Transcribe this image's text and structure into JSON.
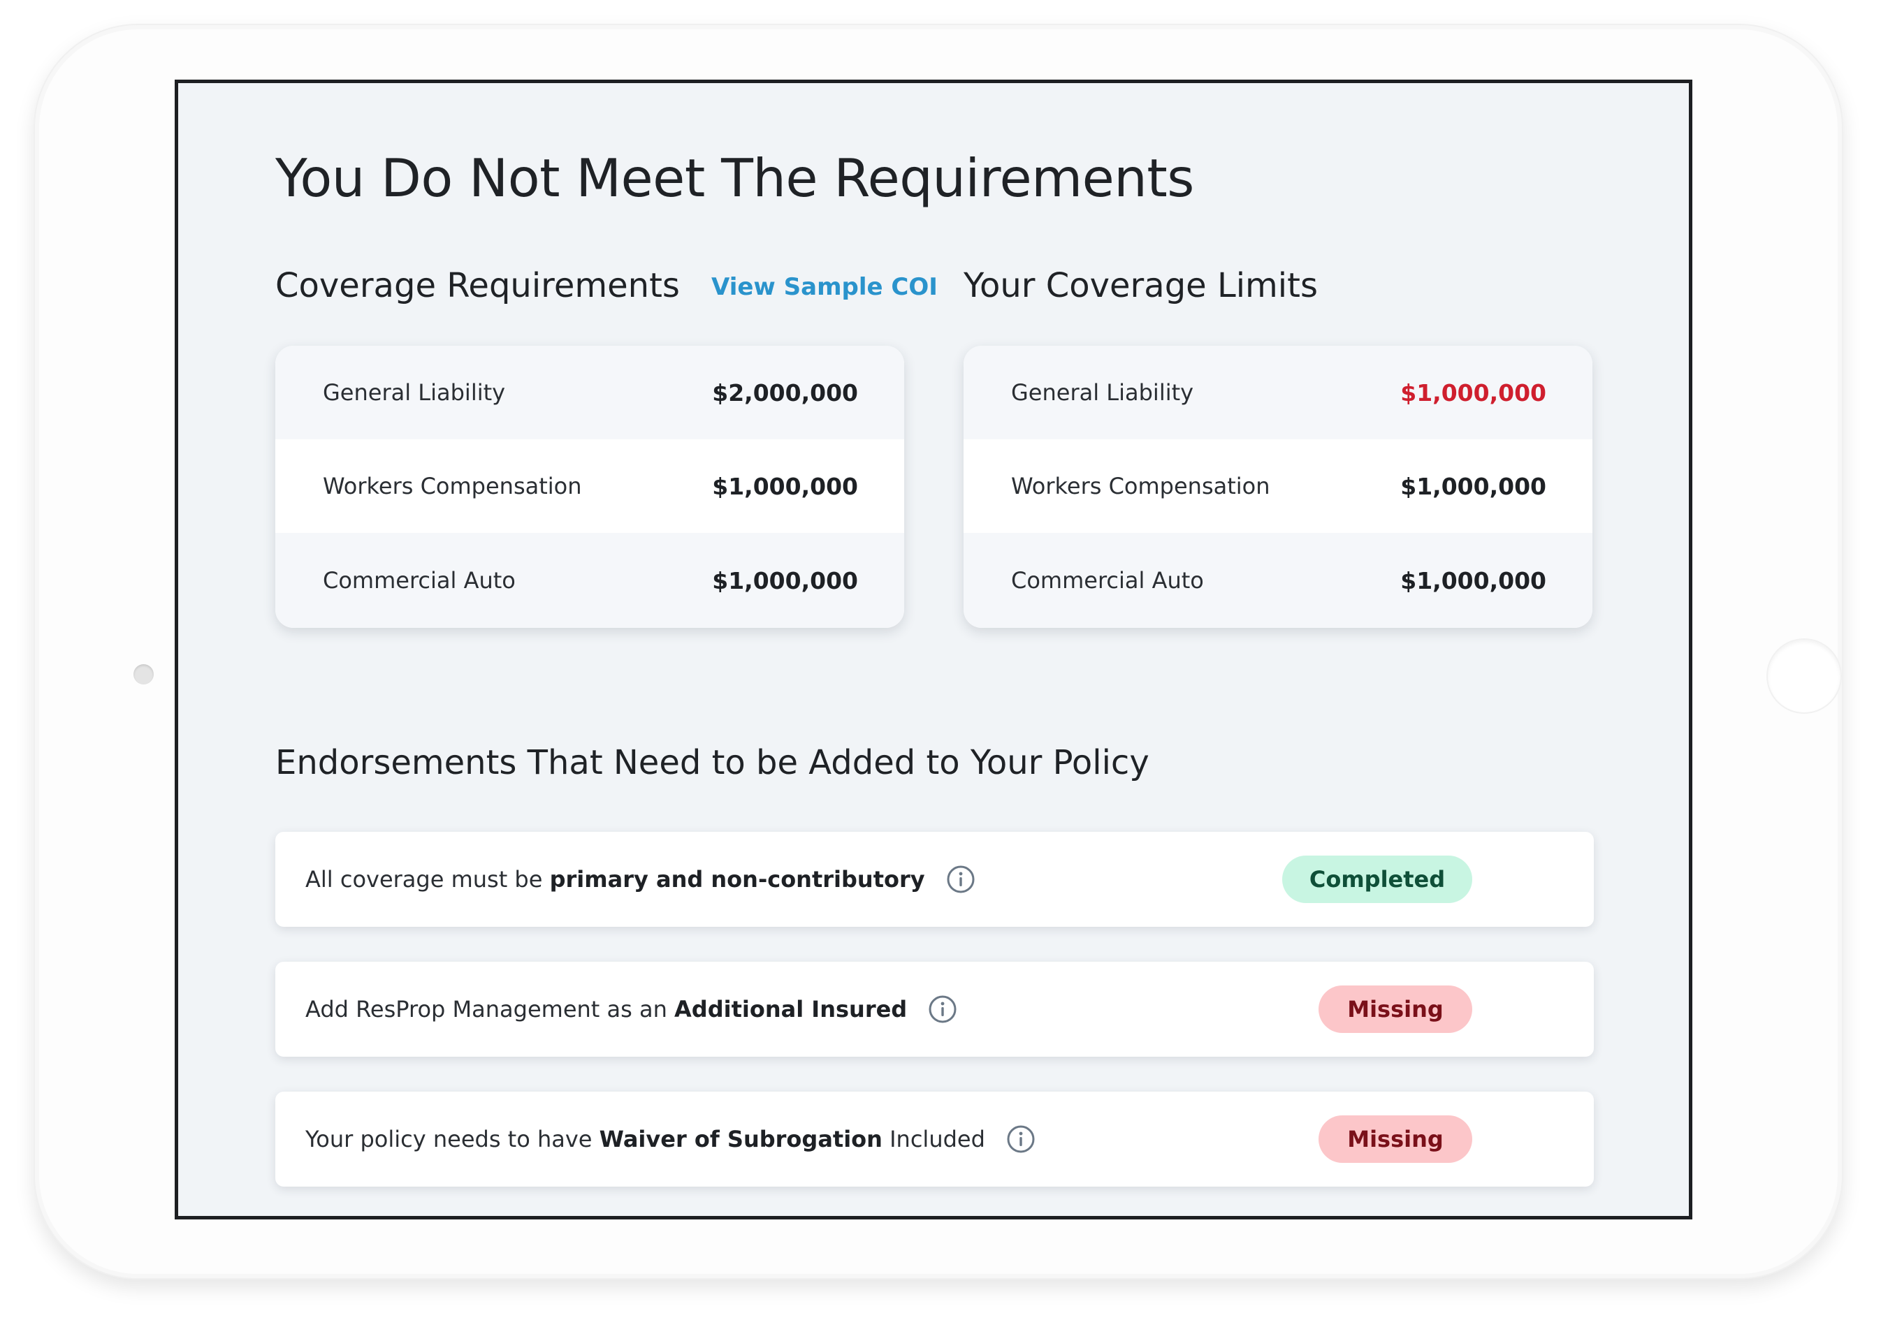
{
  "page": {
    "title": "You Do Not Meet The Requirements"
  },
  "coverage_requirements": {
    "heading": "Coverage Requirements",
    "sample_link": "View Sample COI",
    "rows": [
      {
        "label": "General Liability",
        "value": "$2,000,000"
      },
      {
        "label": "Workers Compensation",
        "value": "$1,000,000"
      },
      {
        "label": "Commercial Auto",
        "value": "$1,000,000"
      }
    ]
  },
  "coverage_limits": {
    "heading": "Your Coverage Limits",
    "rows": [
      {
        "label": "General Liability",
        "value": "$1,000,000",
        "status": "below-requirement"
      },
      {
        "label": "Workers Compensation",
        "value": "$1,000,000",
        "status": "ok"
      },
      {
        "label": "Commercial Auto",
        "value": "$1,000,000",
        "status": "ok"
      }
    ]
  },
  "endorsements": {
    "heading": "Endorsements That Need to be Added to Your Policy",
    "items": [
      {
        "prefix": "All coverage must be ",
        "emphasis": "primary and non-contributory",
        "suffix": "",
        "status": "Completed"
      },
      {
        "prefix": "Add ResProp Management as an ",
        "emphasis": "Additional Insured",
        "suffix": "",
        "status": "Missing"
      },
      {
        "prefix": "Your policy needs to have ",
        "emphasis": "Waiver of Subrogation",
        "suffix": " Included",
        "status": "Missing"
      }
    ]
  },
  "colors": {
    "screen_background": "#f1f4f7",
    "link": "#2a93cc",
    "danger_value": "#cf1f2e",
    "completed_badge_bg": "#c8f5e2",
    "completed_badge_text": "#0f4f38",
    "missing_badge_bg": "#fcc6c9",
    "missing_badge_text": "#7a1019"
  },
  "icons": {
    "endorsement_info": "info-circle-icon"
  }
}
